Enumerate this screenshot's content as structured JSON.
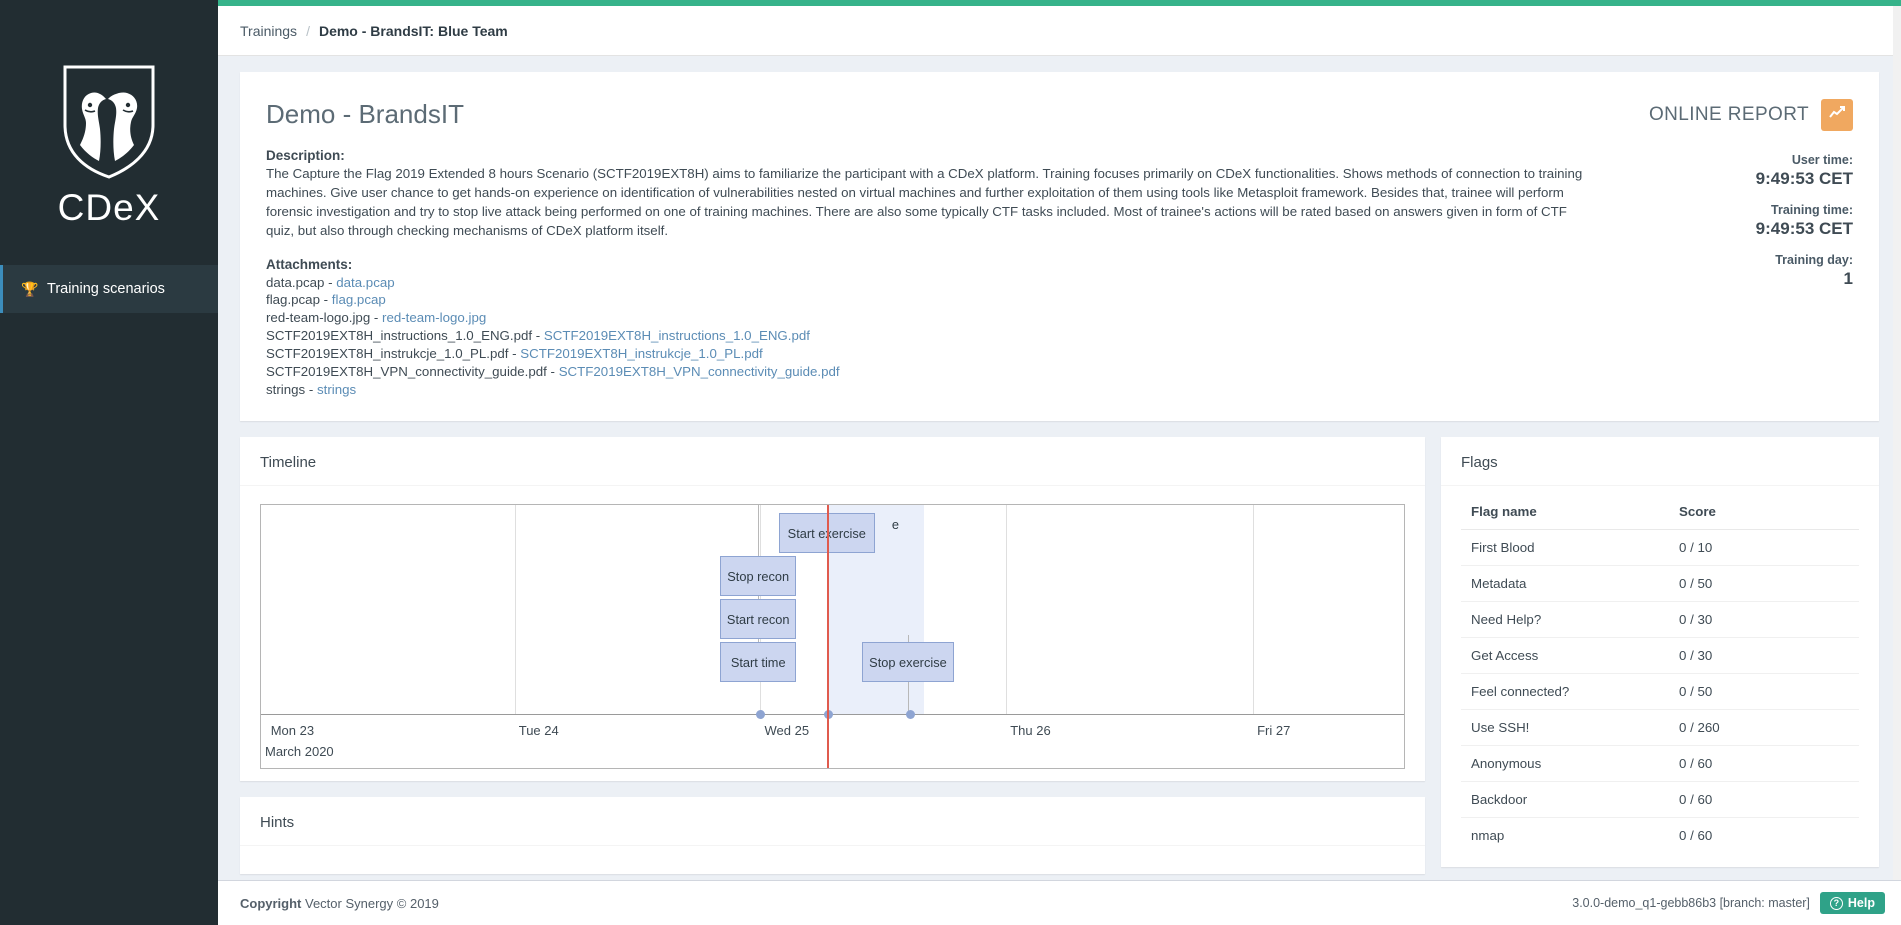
{
  "sidebar": {
    "logo_text": "CDeX",
    "logo_icon": "shield-lion-dragon-icon",
    "items": [
      {
        "label": "Training scenarios",
        "icon": "trophy-icon"
      }
    ]
  },
  "breadcrumb": {
    "root": "Trainings",
    "separator": "/",
    "current": "Demo - BrandsIT: Blue Team"
  },
  "overview": {
    "title": "Demo - BrandsIT",
    "description_label": "Description:",
    "description": "The Capture the Flag 2019 Extended 8 hours Scenario (SCTF2019EXT8H) aims to familiarize the participant with a CDeX platform. Training focuses primarily on CDeX functionalities. Shows methods of connection to training machines. Give user chance to get hands-on experience on identification of vulnerabilities nested on virtual machines and further exploitation of them using tools like Metasploit framework. Besides that, trainee will perform forensic investigation and try to stop live attack being performed on one of training machines. There are also some typically CTF tasks included. Most of trainee's actions will be rated based on answers given in form of CTF quiz, but also through checking mechanisms of CDeX platform itself.",
    "attachments_label": "Attachments:",
    "attachments": [
      {
        "name": "data.pcap",
        "link": "data.pcap"
      },
      {
        "name": "flag.pcap",
        "link": "flag.pcap"
      },
      {
        "name": "red-team-logo.jpg",
        "link": "red-team-logo.jpg"
      },
      {
        "name": "SCTF2019EXT8H_instructions_1.0_ENG.pdf",
        "link": "SCTF2019EXT8H_instructions_1.0_ENG.pdf"
      },
      {
        "name": "SCTF2019EXT8H_instrukcje_1.0_PL.pdf",
        "link": "SCTF2019EXT8H_instrukcje_1.0_PL.pdf"
      },
      {
        "name": "SCTF2019EXT8H_VPN_connectivity_guide.pdf",
        "link": "SCTF2019EXT8H_VPN_connectivity_guide.pdf"
      },
      {
        "name": "strings",
        "link": "strings"
      }
    ],
    "separator": " - "
  },
  "report": {
    "title": "ONLINE REPORT",
    "button_icon": "chart-line-icon",
    "accent_color": "#f0a860",
    "stats": [
      {
        "label": "User time:",
        "value": "9:49:53 CET"
      },
      {
        "label": "Training time:",
        "value": "9:49:53 CET"
      },
      {
        "label": "Training day:",
        "value": "1"
      }
    ]
  },
  "timeline": {
    "title": "Timeline",
    "chart_data": {
      "type": "timeline",
      "title": "Timeline",
      "month_label": "March 2020",
      "axis_ticks": [
        "Mon 23",
        "Tue 24",
        "Wed 25",
        "Thu 26",
        "Fri 27"
      ],
      "now_marker_color": "#e05b4e",
      "events": [
        {
          "label": "Start exercise",
          "row": 0
        },
        {
          "label": "Stop recon",
          "row": 1
        },
        {
          "label": "Start recon",
          "row": 2
        },
        {
          "label": "Start time",
          "row": 3
        },
        {
          "label": "Stop exercise",
          "row": 3
        }
      ],
      "truncated_label": "e"
    }
  },
  "flags": {
    "title": "Flags",
    "columns": [
      "Flag name",
      "Score"
    ],
    "rows": [
      {
        "name": "First Blood",
        "score": "0 / 10"
      },
      {
        "name": "Metadata",
        "score": "0 / 50"
      },
      {
        "name": "Need Help?",
        "score": "0 / 30"
      },
      {
        "name": "Get Access",
        "score": "0 / 30"
      },
      {
        "name": "Feel connected?",
        "score": "0 / 50"
      },
      {
        "name": "Use SSH!",
        "score": "0 / 260"
      },
      {
        "name": "Anonymous",
        "score": "0 / 60"
      },
      {
        "name": "Backdoor",
        "score": "0 / 60"
      },
      {
        "name": "nmap",
        "score": "0 / 60"
      }
    ]
  },
  "hints": {
    "title": "Hints"
  },
  "footer": {
    "copyright_bold": "Copyright",
    "copyright_rest": " Vector Synergy © 2019",
    "version": "3.0.0-demo_q1-gebb86b3 [branch: master]",
    "help_label": "Help",
    "help_icon": "question-circle-icon",
    "help_color": "#2fa288"
  }
}
